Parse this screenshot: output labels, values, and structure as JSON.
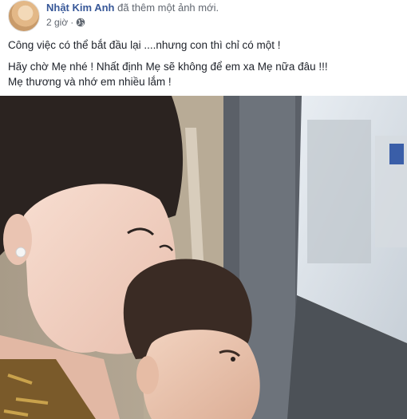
{
  "post": {
    "author": "Nhật Kim Anh",
    "action": "đã thêm một ảnh mới.",
    "time": "2 giờ",
    "privacy_icon": "globe-icon",
    "lines": [
      "Công việc có thể bắt đầu lại ....nhưng con thì chỉ có một !",
      "Hãy chờ Mẹ nhé ! Nhất định Mẹ sẽ không để em xa Mẹ nữa đâu !!!",
      "Mẹ thương và nhớ em nhiều lắm !"
    ]
  },
  "colors": {
    "author_link": "#385898",
    "meta_text": "#616770",
    "body_text": "#1d2129"
  }
}
